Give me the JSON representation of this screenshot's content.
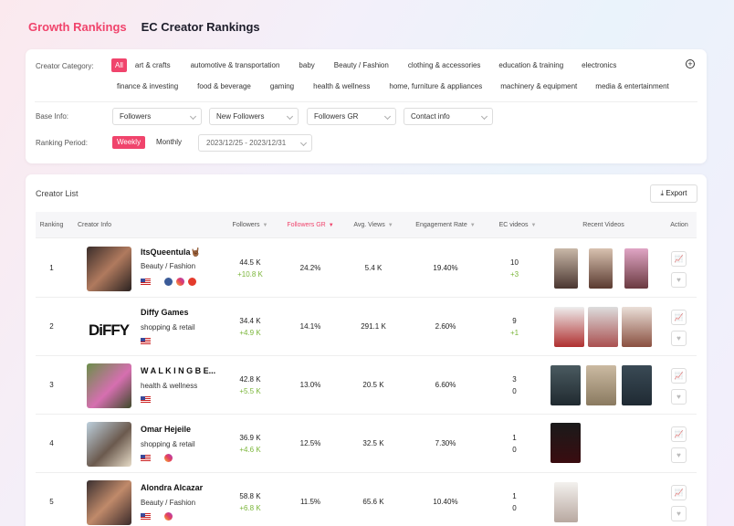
{
  "tabs": [
    {
      "label": "Growth Rankings",
      "active": true
    },
    {
      "label": "EC Creator Rankings",
      "active": false
    }
  ],
  "filters": {
    "category_label": "Creator Category:",
    "categories_row1": [
      "All",
      "art & crafts",
      "automotive & transportation",
      "baby",
      "Beauty / Fashion",
      "clothing & accessories",
      "education & training",
      "electronics"
    ],
    "categories_row2": [
      "finance & investing",
      "food & beverage",
      "gaming",
      "health & wellness",
      "home, furniture & appliances",
      "machinery & equipment",
      "media & entertainment"
    ],
    "selected_category": "All",
    "base_info_label": "Base Info:",
    "base_info_selects": [
      "Followers",
      "New Followers",
      "Followers GR",
      "Contact info"
    ],
    "period_label": "Ranking Period:",
    "period_options": [
      "Weekly",
      "Monthly"
    ],
    "selected_period": "Weekly",
    "date_range": "2023/12/25 - 2023/12/31"
  },
  "list": {
    "title": "Creator List",
    "export_label": "Export",
    "columns": [
      "Ranking",
      "Creator Info",
      "Followers",
      "Followers GR",
      "Avg. Views",
      "Engagement Rate",
      "EC videos",
      "Recent Videos",
      "Action"
    ],
    "sorted_column": "Followers GR",
    "rows": [
      {
        "rank": "1",
        "name": "ItsQueentula🤘🏾",
        "category": "Beauty / Fashion",
        "followers": "44.5 K",
        "followers_delta": "+10.8 K",
        "followers_gr": "24.2%",
        "avg_views": "5.4 K",
        "engagement": "19.40%",
        "ec_videos": "10",
        "ec_delta": "+3",
        "socials": [
          "tiktok",
          "instagram",
          "youtube"
        ],
        "videos": 3
      },
      {
        "rank": "2",
        "name": "Diffy Games",
        "category": "shopping & retail",
        "followers": "34.4 K",
        "followers_delta": "+4.9 K",
        "followers_gr": "14.1%",
        "avg_views": "291.1 K",
        "engagement": "2.60%",
        "ec_videos": "9",
        "ec_delta": "+1",
        "socials": [],
        "videos": 3
      },
      {
        "rank": "3",
        "name": "W A L K I N G B E...",
        "category": "health & wellness",
        "followers": "42.8 K",
        "followers_delta": "+5.5 K",
        "followers_gr": "13.0%",
        "avg_views": "20.5 K",
        "engagement": "6.60%",
        "ec_videos": "3",
        "ec_delta": "0",
        "socials": [],
        "videos": 3
      },
      {
        "rank": "4",
        "name": "Omar Hejeile",
        "category": "shopping & retail",
        "followers": "36.9 K",
        "followers_delta": "+4.6 K",
        "followers_gr": "12.5%",
        "avg_views": "32.5 K",
        "engagement": "7.30%",
        "ec_videos": "1",
        "ec_delta": "0",
        "socials": [
          "instagram"
        ],
        "videos": 1
      },
      {
        "rank": "5",
        "name": "Alondra Alcazar",
        "category": "Beauty / Fashion",
        "followers": "58.8 K",
        "followers_delta": "+6.8 K",
        "followers_gr": "11.5%",
        "avg_views": "65.6 K",
        "engagement": "10.40%",
        "ec_videos": "1",
        "ec_delta": "0",
        "socials": [
          "instagram"
        ],
        "videos": 1
      }
    ]
  },
  "colors": {
    "accent": "#f0446c",
    "growth": "#7bb63a"
  }
}
